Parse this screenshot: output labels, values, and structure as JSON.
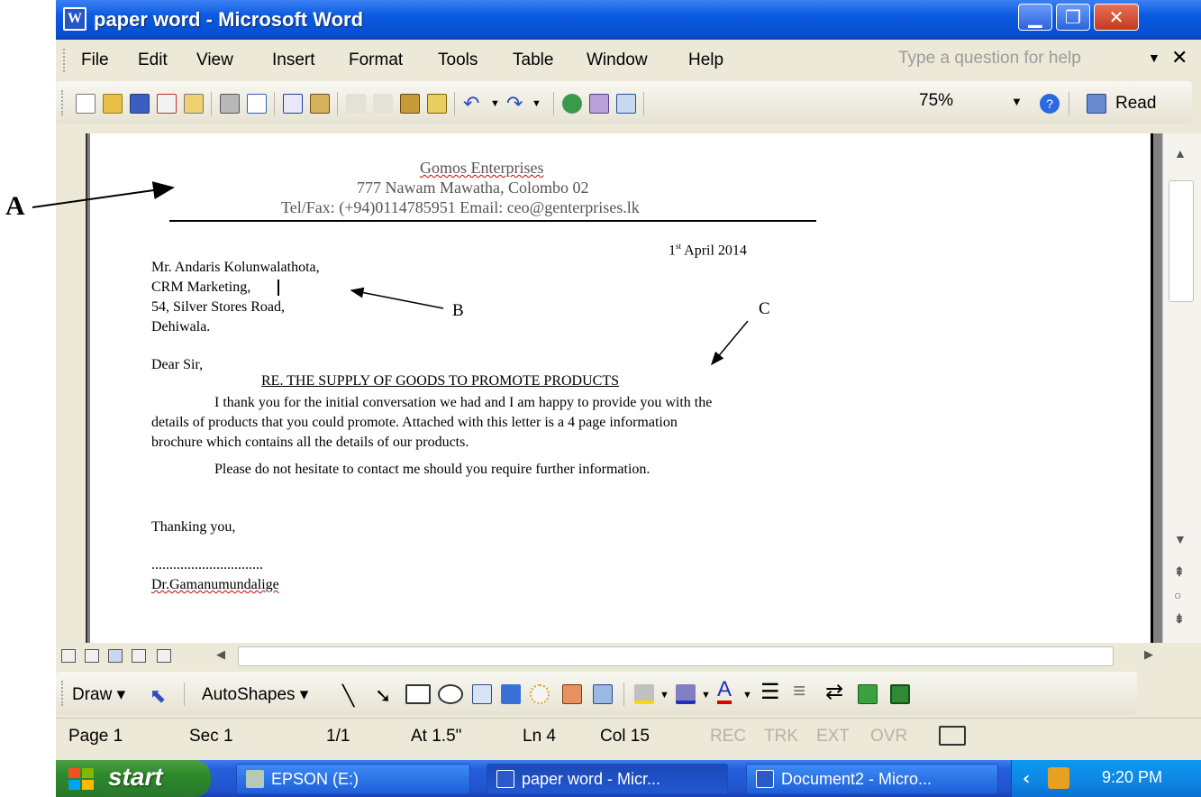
{
  "window": {
    "title": "paper word - Microsoft Word"
  },
  "annotations": {
    "a": "A",
    "b": "B",
    "c": "C"
  },
  "menu": [
    "File",
    "Edit",
    "View",
    "Insert",
    "Format",
    "Tools",
    "Table",
    "Window",
    "Help"
  ],
  "help_box_placeholder": "Type a question for help",
  "toolbar": {
    "zoom": "75%",
    "read_label": "Read",
    "icons": [
      "new-icon",
      "open-icon",
      "save-icon",
      "permission-icon",
      "email-icon",
      "print-icon",
      "print-preview-icon",
      "spelling-icon",
      "research-icon",
      "cut-icon",
      "copy-icon",
      "paste-icon",
      "format-painter-icon",
      "undo-icon",
      "redo-icon",
      "hyperlink-icon",
      "tables-borders-icon",
      "insert-table-icon",
      "help-icon",
      "read-icon"
    ]
  },
  "letter": {
    "company": "Gomos Enterprises",
    "address": "777 Nawam Mawatha, Colombo 02",
    "contact": "Tel/Fax: (+94)0114785951 Email: ceo@genterprises.lk",
    "date_day": "1",
    "date_suffix": "st",
    "date_rest": "April 2014",
    "recipient": [
      "Mr. Andaris Kolunwalathota,",
      "CRM Marketing,",
      "54, Silver Stores Road,",
      "Dehiwala."
    ],
    "salutation": "Dear Sir,",
    "subject": "RE. THE SUPPLY OF GOODS TO PROMOTE PRODUCTS",
    "para1": [
      "I thank you for the initial conversation we had and I am happy to provide you with the",
      "details of products that you could promote. Attached with this letter is a 4 page information",
      "brochure which contains all the details of our products."
    ],
    "para2": "Please do not hesitate to contact me should you require further information.",
    "closing": "Thanking you,",
    "signature_line": "...............................",
    "signatory": "Dr.Gamanumundalige"
  },
  "drawing_toolbar": {
    "draw_label": "Draw",
    "autoshapes_label": "AutoShapes",
    "icons": [
      "select-objects-icon",
      "line-icon",
      "arrow-icon",
      "rectangle-icon",
      "oval-icon",
      "text-box-icon",
      "wordart-icon",
      "diagram-icon",
      "clip-art-icon",
      "picture-icon",
      "fill-color-icon",
      "line-color-icon",
      "font-color-icon",
      "line-style-icon",
      "dash-style-icon",
      "arrow-style-icon",
      "shadow-icon",
      "3d-icon"
    ],
    "font_color_letter": "A"
  },
  "status": {
    "page": "Page 1",
    "section": "Sec 1",
    "page_of": "1/1",
    "at": "At 1.5\"",
    "line": "Ln 4",
    "col": "Col 15",
    "rec": "REC",
    "trk": "TRK",
    "ext": "EXT",
    "ovr": "OVR"
  },
  "taskbar": {
    "start": "start",
    "buttons": [
      "EPSON (E:)",
      "paper word - Micr...",
      "Document2 - Micro..."
    ],
    "clock": "9:20 PM"
  },
  "colors": {
    "title_bar": "#0a5ae0",
    "start_button": "#2f8a2c",
    "spell_underline": "#d00000",
    "font_color_red": "#e00000"
  }
}
